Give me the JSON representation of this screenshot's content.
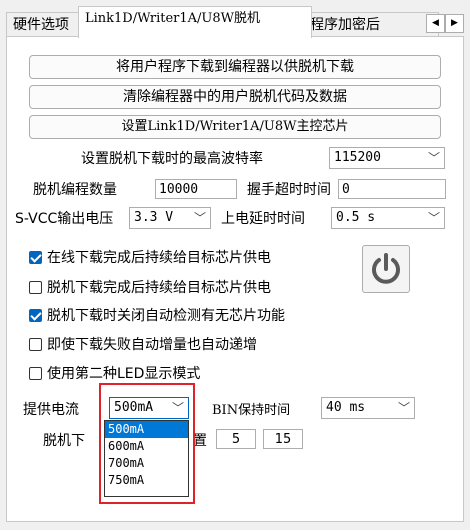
{
  "tabs": [
    "硬件选项",
    "Link1D/Writer1A/U8W脱机",
    "程序加密后"
  ],
  "buttons": {
    "download": "将用户程序下载到编程器以供脱机下载",
    "clear": "清除编程器中的用户脱机代码及数据",
    "set_chip": "设置Link1D/Writer1A/U8W主控芯片"
  },
  "baud": {
    "label": "设置脱机下载时的最高波特率",
    "value": "115200"
  },
  "count": {
    "label": "脱机编程数量",
    "value": "10000"
  },
  "handshake": {
    "label": "握手超时时间",
    "value": "0"
  },
  "svcc": {
    "label": "S-VCC输出电压",
    "value": "3.3 V"
  },
  "powerup": {
    "label": "上电延时时间",
    "value": "0.5 s"
  },
  "checkboxes": [
    {
      "label": "在线下载完成后持续给目标芯片供电",
      "checked": true
    },
    {
      "label": "脱机下载完成后持续给目标芯片供电",
      "checked": false
    },
    {
      "label": "脱机下载时关闭自动检测有无芯片功能",
      "checked": true
    },
    {
      "label": "即使下载失败自动增量也自动递增",
      "checked": false
    },
    {
      "label": "使用第二种LED显示模式",
      "checked": false
    }
  ],
  "current": {
    "label": "提供电流",
    "value": "500mA",
    "options": [
      "500mA",
      "600mA",
      "700mA",
      "750mA"
    ]
  },
  "bin": {
    "label": "BIN保持时间",
    "value": "40 ms"
  },
  "offline": {
    "label_left": "脱机下",
    "label_right": "置",
    "v1": "5",
    "v2": "15"
  },
  "colors": {
    "accent": "#0067c0",
    "highlight": "#e0232b",
    "selected": "#0078d7"
  }
}
